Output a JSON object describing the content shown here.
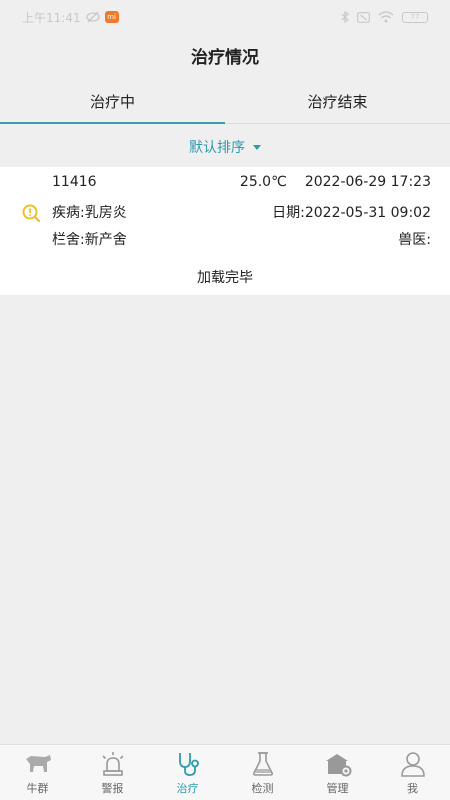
{
  "status_bar": {
    "time": "上午11:41",
    "mi_badge": "mi",
    "battery": "77"
  },
  "header": {
    "title": "治疗情况"
  },
  "tabs": [
    {
      "label": "治疗中",
      "active": true
    },
    {
      "label": "治疗结束",
      "active": false
    }
  ],
  "sort": {
    "label": "默认排序"
  },
  "records": [
    {
      "id": "11416",
      "temperature": "25.0℃",
      "timestamp": "2022-06-29 17:23",
      "disease": "疾病:乳房炎",
      "date": "日期:2022-05-31 09:02",
      "barn": "栏舍:新产舍",
      "vet": "兽医:"
    }
  ],
  "list_footer": "加载完毕",
  "bottom_nav": [
    {
      "label": "牛群",
      "icon": "cow-icon",
      "active": false
    },
    {
      "label": "警报",
      "icon": "alarm-icon",
      "active": false
    },
    {
      "label": "治疗",
      "icon": "stethoscope-icon",
      "active": true
    },
    {
      "label": "检测",
      "icon": "flask-icon",
      "active": false
    },
    {
      "label": "管理",
      "icon": "barn-gear-icon",
      "active": false
    },
    {
      "label": "我",
      "icon": "user-icon",
      "active": false
    }
  ],
  "colors": {
    "accent": "#2e9bb0",
    "warning_icon": "#f0c020"
  }
}
